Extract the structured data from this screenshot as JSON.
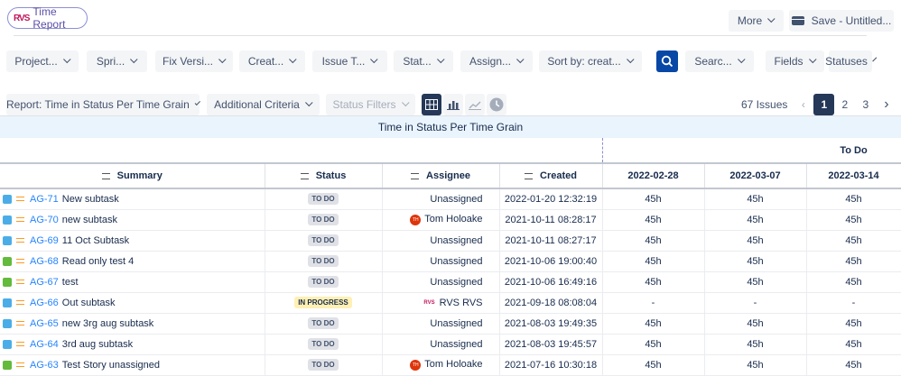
{
  "app": {
    "title": "Time Report",
    "logo": "RVS"
  },
  "header": {
    "more": "More",
    "save": "Save - Untitled..."
  },
  "filters": [
    "Project...",
    "Spri...",
    "Fix Versi...",
    "Creat...",
    "Issue T...",
    "Stat...",
    "Assign...",
    "Sort by: creat...",
    "Searc...",
    "Fields",
    "Statuses"
  ],
  "toolbar": {
    "report": "Report: Time in Status Per Time Grain",
    "additional": "Additional Criteria",
    "status_filters": "Status Filters"
  },
  "pagination": {
    "count": "67 Issues",
    "pages": [
      "1",
      "2",
      "3"
    ],
    "current": "1"
  },
  "report_title": "Time in Status Per Time Grain",
  "table": {
    "group": "To Do",
    "columns": [
      "Summary",
      "Status",
      "Assignee",
      "Created",
      "2022-02-28",
      "2022-03-07",
      "2022-03-14"
    ],
    "rows": [
      {
        "type": "subtask",
        "key": "AG-71",
        "summary": "New subtask",
        "status": "TO DO",
        "assignee": "Unassigned",
        "avatar": "",
        "created": "2022-01-20 12:32:19",
        "v": [
          "45h",
          "45h",
          "45h"
        ]
      },
      {
        "type": "subtask",
        "key": "AG-70",
        "summary": "new subtask",
        "status": "TO DO",
        "assignee": "Tom Holoake",
        "avatar": "TH",
        "created": "2021-10-11 08:28:17",
        "v": [
          "45h",
          "45h",
          "45h"
        ]
      },
      {
        "type": "subtask",
        "key": "AG-69",
        "summary": "11 Oct Subtask",
        "status": "TO DO",
        "assignee": "Unassigned",
        "avatar": "",
        "created": "2021-10-11 08:27:17",
        "v": [
          "45h",
          "45h",
          "45h"
        ]
      },
      {
        "type": "story",
        "key": "AG-68",
        "summary": "Read only test 4",
        "status": "TO DO",
        "assignee": "Unassigned",
        "avatar": "",
        "created": "2021-10-06 19:00:40",
        "v": [
          "45h",
          "45h",
          "45h"
        ]
      },
      {
        "type": "story",
        "key": "AG-67",
        "summary": "test",
        "status": "TO DO",
        "assignee": "Unassigned",
        "avatar": "",
        "created": "2021-10-06 16:49:16",
        "v": [
          "45h",
          "45h",
          "45h"
        ]
      },
      {
        "type": "subtask",
        "key": "AG-66",
        "summary": "Out subtask",
        "status": "IN PROGRESS",
        "assignee": "RVS RVS",
        "avatar": "RVS",
        "created": "2021-09-18 08:08:04",
        "v": [
          "-",
          "-",
          "-"
        ]
      },
      {
        "type": "subtask",
        "key": "AG-65",
        "summary": "new 3rg aug subtask",
        "status": "TO DO",
        "assignee": "Unassigned",
        "avatar": "",
        "created": "2021-08-03 19:49:35",
        "v": [
          "45h",
          "45h",
          "45h"
        ]
      },
      {
        "type": "subtask",
        "key": "AG-64",
        "summary": "3rd aug subtask",
        "status": "TO DO",
        "assignee": "Unassigned",
        "avatar": "",
        "created": "2021-08-03 19:45:57",
        "v": [
          "45h",
          "45h",
          "45h"
        ]
      },
      {
        "type": "story",
        "key": "AG-63",
        "summary": "Test Story unassigned",
        "status": "TO DO",
        "assignee": "Tom Holoake",
        "avatar": "TH",
        "created": "2021-07-16 10:30:18",
        "v": [
          "45h",
          "45h",
          "45h"
        ]
      }
    ]
  }
}
